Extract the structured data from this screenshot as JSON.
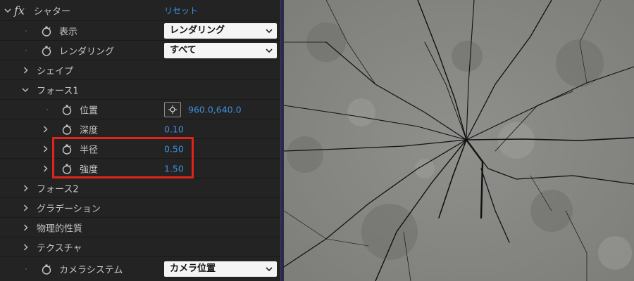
{
  "effect": {
    "fx_label": "fx",
    "name": "シャター",
    "reset_label": "リセット"
  },
  "rows": {
    "view": {
      "label": "表示",
      "value": "レンダリング"
    },
    "render": {
      "label": "レンダリング",
      "value": "すべて"
    },
    "shape": {
      "label": "シェイプ"
    },
    "force1": {
      "label": "フォース1"
    },
    "position": {
      "label": "位置",
      "value": "960.0,640.0"
    },
    "depth": {
      "label": "深度",
      "value": "0.10"
    },
    "radius": {
      "label": "半径",
      "value": "0.50"
    },
    "strength": {
      "label": "強度",
      "value": "1.50"
    },
    "force2": {
      "label": "フォース2"
    },
    "gradient": {
      "label": "グラデーション"
    },
    "physics": {
      "label": "物理的性質"
    },
    "texture": {
      "label": "テクスチャ"
    },
    "camera": {
      "label": "カメラシステム",
      "value": "カメラ位置"
    }
  },
  "icons": {
    "stopwatch": "stopwatch-icon",
    "chevron_right": "chevron-right-icon",
    "chevron_down": "chevron-down-icon",
    "crosshair": "crosshair-icon"
  },
  "colors": {
    "accent": "#3f8fe0",
    "highlight": "#e2231a",
    "panel": "#232323"
  }
}
